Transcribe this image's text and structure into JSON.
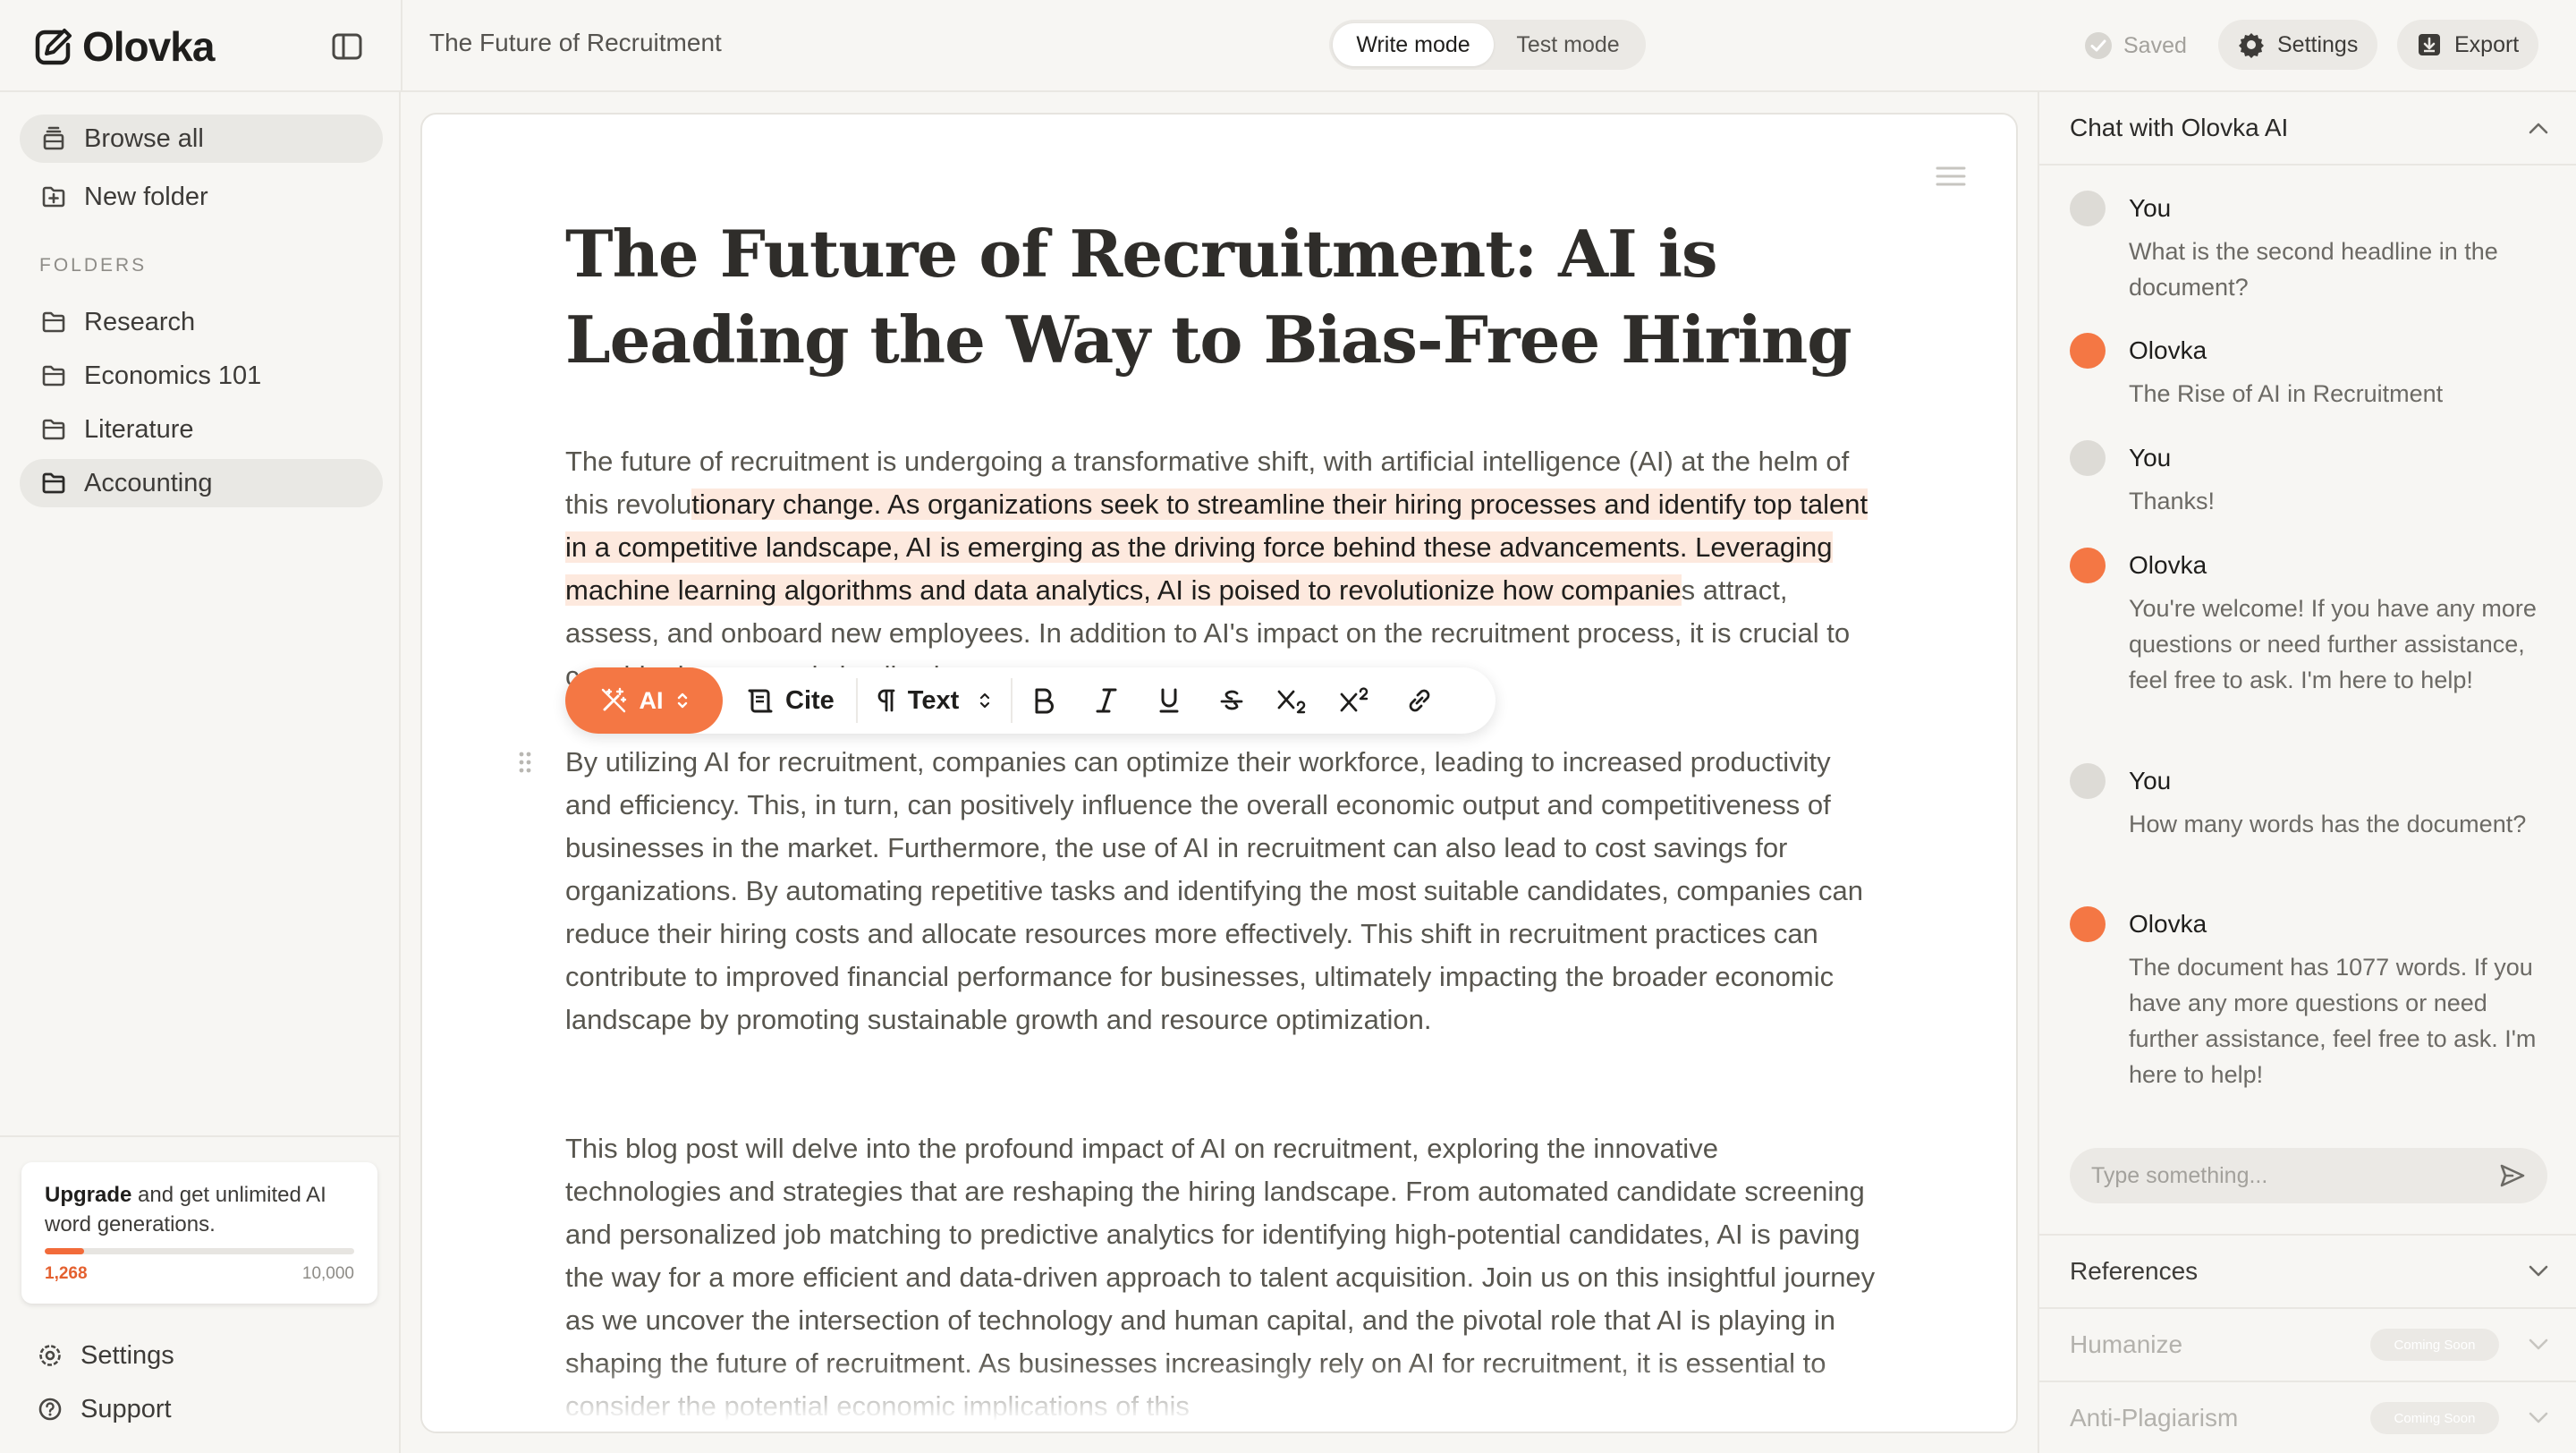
{
  "app": {
    "name": "Olovka",
    "document_title": "The Future of Recruitment"
  },
  "modes": {
    "write": "Write mode",
    "test": "Test mode",
    "active": "write"
  },
  "status": {
    "saved": "Saved"
  },
  "header_actions": {
    "settings": "Settings",
    "export": "Export"
  },
  "sidebar": {
    "nav": [
      {
        "label": "Browse all",
        "icon": "inbox-stack-icon",
        "active": true
      },
      {
        "label": "New folder",
        "icon": "folder-plus-icon",
        "active": false
      }
    ],
    "folders_heading": "FOLDERS",
    "folders": [
      {
        "label": "Research",
        "active": false
      },
      {
        "label": "Economics 101",
        "active": false
      },
      {
        "label": "Literature",
        "active": false
      },
      {
        "label": "Accounting",
        "active": true
      }
    ],
    "upgrade": {
      "strong": "Upgrade",
      "rest": " and get unlimited AI word generations.",
      "used": "1,268",
      "limit": "10,000",
      "progress_fraction": 0.1268
    },
    "footer": [
      {
        "label": "Settings",
        "icon": "gear-icon"
      },
      {
        "label": "Support",
        "icon": "question-circle-icon"
      }
    ]
  },
  "document": {
    "title": "The Future of Recruitment: AI is Leading the Way to Bias-Free Hiring",
    "paragraph1": {
      "before": "The future of recruitment is undergoing a transformative shift, with artificial intelligence (AI) at the helm of this revolu",
      "highlight": "tionary change. As organizations seek to streamline their hiring processes and identify top talent in a competitive landscape, AI is emerging as the driving force behind these advancements. Leveraging machine learning algorithms and data analytics, AI is poised to revolutionize how companie",
      "after": "s attract, assess, and onboard new employees. In addition to AI's impact on the recruitment process, it is crucial to consider its economic implications."
    },
    "paragraph2": "By utilizing AI for recruitment, companies can optimize their workforce, leading to increased productivity and efficiency. This, in turn, can positively influence the overall economic output and competitiveness of businesses in the market. Furthermore, the use of AI in recruitment can also lead to cost savings for organizations. By automating repetitive tasks and identifying the most suitable candidates, companies can reduce their hiring costs and allocate resources more effectively. This shift in recruitment practices can contribute to improved financial performance for businesses, ultimately impacting the broader economic landscape by promoting sustainable growth and resource optimization.",
    "paragraph3": "This blog post will delve into the profound impact of AI on recruitment, exploring the innovative technologies and strategies that are reshaping the hiring landscape. From automated candidate screening and personalized job matching to predictive analytics for identifying high-potential candidates, AI is paving the way for a more efficient and data-driven approach to talent acquisition. Join us on this insightful journey as we uncover the intersection of technology and human capital, and the pivotal role that AI is playing in shaping the future of recruitment. As businesses increasingly rely on AI for recruitment, it is essential to consider the potential economic implications of this"
  },
  "toolbar": {
    "ai": "AI",
    "cite": "Cite",
    "text": "Text",
    "format_icons": [
      "bold-icon",
      "italic-icon",
      "underline-icon",
      "strikethrough-icon",
      "subscript-icon",
      "superscript-icon",
      "link-icon"
    ]
  },
  "chat": {
    "header": "Chat with Olovka AI",
    "messages": [
      {
        "sender": "You",
        "role": "user",
        "text": "What is the second headline in the document?"
      },
      {
        "sender": "Olovka",
        "role": "bot",
        "text": "The Rise of AI in Recruitment"
      },
      {
        "sender": "You",
        "role": "user",
        "text": "Thanks!"
      },
      {
        "sender": "Olovka",
        "role": "bot",
        "text": "You're welcome! If you have any more questions or need further assistance, feel free to ask. I'm here to help!"
      },
      {
        "sender": "You",
        "role": "user",
        "text": "How many words has the document?"
      },
      {
        "sender": "Olovka",
        "role": "bot",
        "text": "The document has 1077 words. If you have any more questions or need further assistance, feel free to ask. I'm here to help!"
      }
    ],
    "input_placeholder": "Type something..."
  },
  "panels": {
    "references": "References",
    "humanize": "Humanize",
    "anti_plagiarism": "Anti-Plagiarism",
    "coming_soon": "Coming Soon"
  },
  "colors": {
    "accent": "#f47744",
    "highlight": "#fde9de",
    "background": "#f7f6f3"
  }
}
